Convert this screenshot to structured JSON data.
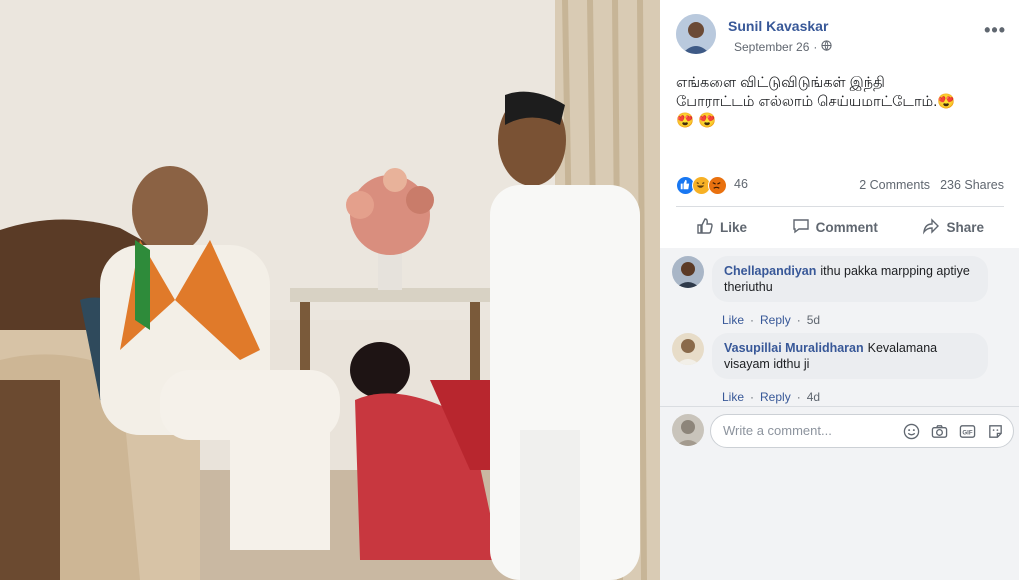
{
  "post": {
    "author": "Sunil Kavaskar",
    "date": "September 26",
    "privacy_icon": "globe-icon",
    "more_icon": "more-options-icon",
    "text_line1": "எங்களை விட்டுவிடுங்கள் இந்தி",
    "text_line2": "போராட்டம் எல்லாம் செய்யமாட்டோம்.😍",
    "text_line3": "😍 😍"
  },
  "stats": {
    "reactions": [
      "like",
      "haha",
      "angry"
    ],
    "reaction_count": "46",
    "comments": "2 Comments",
    "shares": "236 Shares"
  },
  "actions": {
    "like": "Like",
    "comment": "Comment",
    "share": "Share"
  },
  "comments": [
    {
      "name": "Chellapandiyan",
      "text_line1": "ithu pakka marpping aptiye",
      "text_line2": "theriuthu",
      "like": "Like",
      "reply": "Reply",
      "time": "5d"
    },
    {
      "name": "Vasupillai Muralidharan",
      "text_line1": "Kevalamana",
      "text_line2": "visayam idthu ji",
      "like": "Like",
      "reply": "Reply",
      "time": "4d"
    }
  ],
  "composer": {
    "placeholder": "Write a comment...",
    "icons": [
      "emoji-icon",
      "camera-icon",
      "gif-icon",
      "sticker-icon"
    ]
  },
  "colors": {
    "link": "#385898",
    "muted": "#606770",
    "comment_bg": "#f2f3f5",
    "like_blue": "#1877f2",
    "haha_yellow": "#f7b125",
    "angry_orange": "#e9710f"
  }
}
